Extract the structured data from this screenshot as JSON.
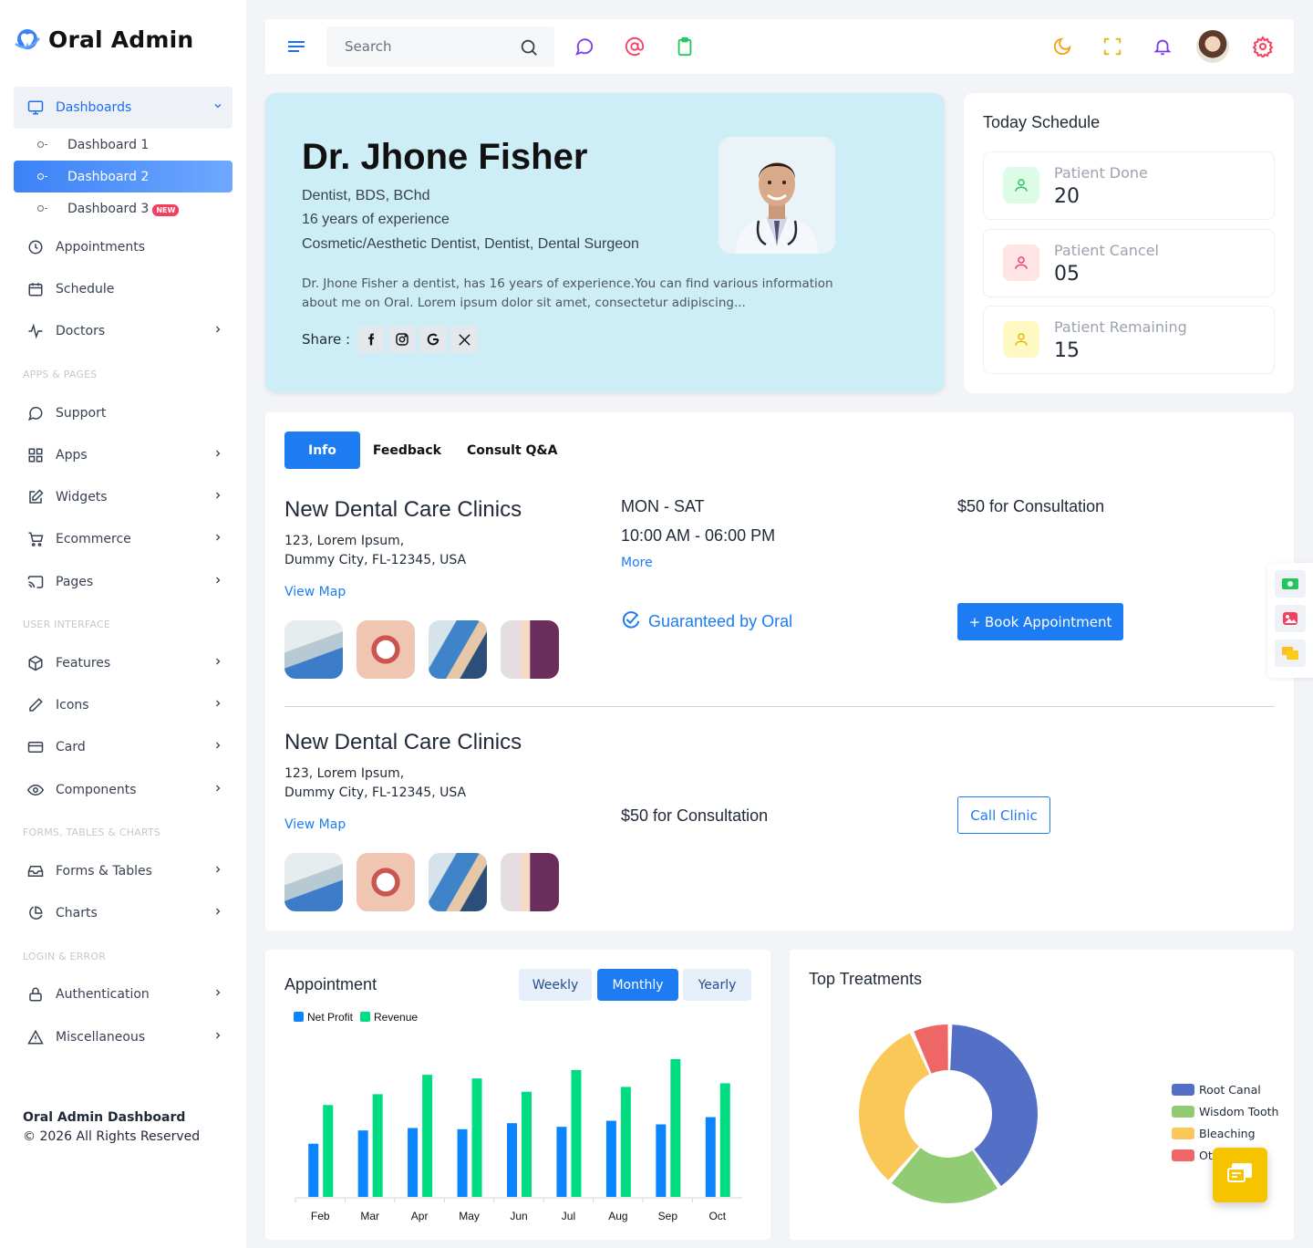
{
  "app": {
    "name": "Oral Admin"
  },
  "sidebar": {
    "dashboards": {
      "label": "Dashboards",
      "items": [
        {
          "label": "Dashboard 1"
        },
        {
          "label": "Dashboard 2"
        },
        {
          "label": "Dashboard 3",
          "badge": "NEW"
        }
      ]
    },
    "main_items": [
      {
        "label": "Appointments",
        "icon": "clock-icon"
      },
      {
        "label": "Schedule",
        "icon": "calendar-icon"
      },
      {
        "label": "Doctors",
        "icon": "activity-icon"
      }
    ],
    "section_apps": "APPS & PAGES",
    "apps_items": [
      {
        "label": "Support",
        "icon": "message-circle-icon"
      },
      {
        "label": "Apps",
        "icon": "grid-icon"
      },
      {
        "label": "Widgets",
        "icon": "edit-icon"
      },
      {
        "label": "Ecommerce",
        "icon": "cart-icon"
      },
      {
        "label": "Pages",
        "icon": "cast-icon"
      }
    ],
    "section_ui": "USER INTERFACE",
    "ui_items": [
      {
        "label": "Features",
        "icon": "box-icon"
      },
      {
        "label": "Icons",
        "icon": "pen-icon"
      },
      {
        "label": "Card",
        "icon": "credit-card-icon"
      },
      {
        "label": "Components",
        "icon": "eye-icon"
      }
    ],
    "section_forms": "FORMS, TABLES & CHARTS",
    "forms_items": [
      {
        "label": "Forms & Tables",
        "icon": "inbox-icon"
      },
      {
        "label": "Charts",
        "icon": "pie-chart-icon"
      }
    ],
    "section_login": "LOGIN & ERROR",
    "login_items": [
      {
        "label": "Authentication",
        "icon": "lock-icon"
      },
      {
        "label": "Miscellaneous",
        "icon": "alert-triangle-icon"
      }
    ],
    "footer": {
      "title": "Oral Admin Dashboard",
      "copyright": "© 2026 All Rights Reserved"
    }
  },
  "topbar": {
    "search_placeholder": "Search"
  },
  "profile": {
    "name": "Dr. Jhone Fisher",
    "degree": "Dentist, BDS, BChd",
    "experience": "16 years of experience",
    "specialties": "Cosmetic/Aesthetic Dentist, Dentist, Dental Surgeon",
    "description": "Dr. Jhone Fisher a dentist, has 16 years of experience.You can find various information about me on Oral. Lorem ipsum dolor sit amet, consectetur adipiscing...",
    "share_label": "Share :"
  },
  "schedule": {
    "title": "Today Schedule",
    "stats": [
      {
        "label": "Patient Done",
        "value": "20",
        "color": "#22c55e",
        "bg": "#dcfce7"
      },
      {
        "label": "Patient Cancel",
        "value": "05",
        "color": "#f43f5e",
        "bg": "#ffe4e6"
      },
      {
        "label": "Patient Remaining",
        "value": "15",
        "color": "#eab308",
        "bg": "#fef9c3"
      }
    ]
  },
  "clinic": {
    "tabs": [
      "Info",
      "Feedback",
      "Consult Q&A"
    ],
    "entries": [
      {
        "title": "New Dental Care Clinics",
        "address1": "123, Lorem Ipsum,",
        "address2": "Dummy City, FL-12345, USA",
        "map_link": "View Map",
        "days": "MON - SAT",
        "hours": "10:00 AM - 06:00 PM",
        "more": "More",
        "fee": "$50 for Consultation",
        "guarantee": "Guaranteed by Oral",
        "action": "+ Book Appointment"
      },
      {
        "title": "New Dental Care Clinics",
        "address1": "123, Lorem Ipsum,",
        "address2": "Dummy City, FL-12345, USA",
        "map_link": "View Map",
        "fee": "$50 for Consultation",
        "action": "Call Clinic"
      }
    ]
  },
  "appointment": {
    "title": "Appointment",
    "periods": [
      "Weekly",
      "Monthly",
      "Yearly"
    ],
    "active_period": "Monthly"
  },
  "treatments": {
    "title": "Top Treatments"
  },
  "chart_data": [
    {
      "type": "bar",
      "categories": [
        "Feb",
        "Mar",
        "Apr",
        "May",
        "Jun",
        "Jul",
        "Aug",
        "Sep",
        "Oct"
      ],
      "series": [
        {
          "name": "Net Profit",
          "color": "#0a84ff",
          "values": [
            44,
            55,
            57,
            56,
            61,
            58,
            63,
            60,
            66
          ]
        },
        {
          "name": "Revenue",
          "color": "#00dc82",
          "values": [
            76,
            85,
            101,
            98,
            87,
            105,
            91,
            114,
            94
          ]
        }
      ],
      "ylim": [
        0,
        120
      ],
      "legend": "top-left",
      "grid": false
    },
    {
      "type": "pie",
      "donut": true,
      "labels": [
        "Root Canal",
        "Wisdom Tooth",
        "Bleaching",
        "Others"
      ],
      "visible_labels": [
        "Root Canal",
        "Wisdom Tooth",
        "Bleaching",
        "Oth"
      ],
      "values": [
        40,
        21,
        32,
        7
      ],
      "colors": [
        "#5470c6",
        "#91cc75",
        "#fac858",
        "#ee6666"
      ],
      "legend": "right"
    }
  ]
}
